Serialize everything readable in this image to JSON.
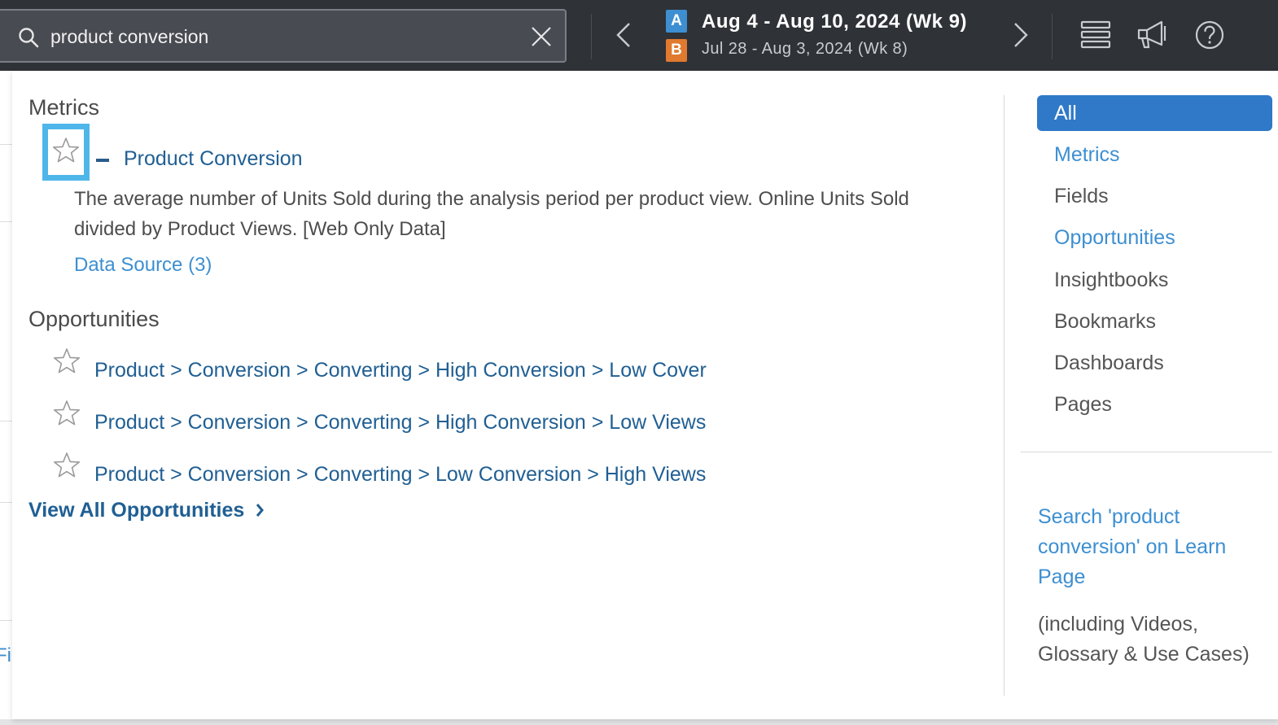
{
  "search": {
    "value": "product conversion"
  },
  "period": {
    "a_badge": "A",
    "a_label": "Aug 4 - Aug 10, 2024 (Wk 9)",
    "b_badge": "B",
    "b_label": "Jul 28 - Aug 3, 2024 (Wk 8)"
  },
  "background": {
    "partial_text": "Fi"
  },
  "metrics": {
    "section_title": "Metrics",
    "item": {
      "title": "Product Conversion",
      "description": "The average number of Units Sold during the analysis period per product view. Online Units Sold divided by Product Views. [Web Only Data]",
      "data_source": "Data Source (3)"
    }
  },
  "opportunities": {
    "section_title": "Opportunities",
    "items": [
      "Product > Conversion > Converting > High Conversion > Low Cover",
      "Product > Conversion > Converting > High Conversion > Low Views",
      "Product > Conversion > Converting > Low Conversion > High Views"
    ],
    "view_all": "View All Opportunities"
  },
  "filters": [
    "All",
    "Metrics",
    "Fields",
    "Opportunities",
    "Insightbooks",
    "Bookmarks",
    "Dashboards",
    "Pages"
  ],
  "learn": {
    "link": "Search 'product conversion' on Learn Page",
    "note": "(including Videos, Glossary & Use Cases)"
  },
  "colors": {
    "topbar": "#2f3237",
    "accent_blue": "#3d8fd1",
    "link_dark_blue": "#205f93",
    "active_filter": "#2f79c8",
    "badge_b": "#e07a2e",
    "focus_ring": "#4fb6ea"
  },
  "icons": {
    "search": "search-icon",
    "clear": "close-icon",
    "prev": "chevron-left-icon",
    "next": "chevron-right-icon",
    "layout": "stack-icon",
    "announce": "megaphone-icon",
    "help": "help-icon",
    "favorite": "star-icon",
    "collapse": "minus-icon"
  }
}
